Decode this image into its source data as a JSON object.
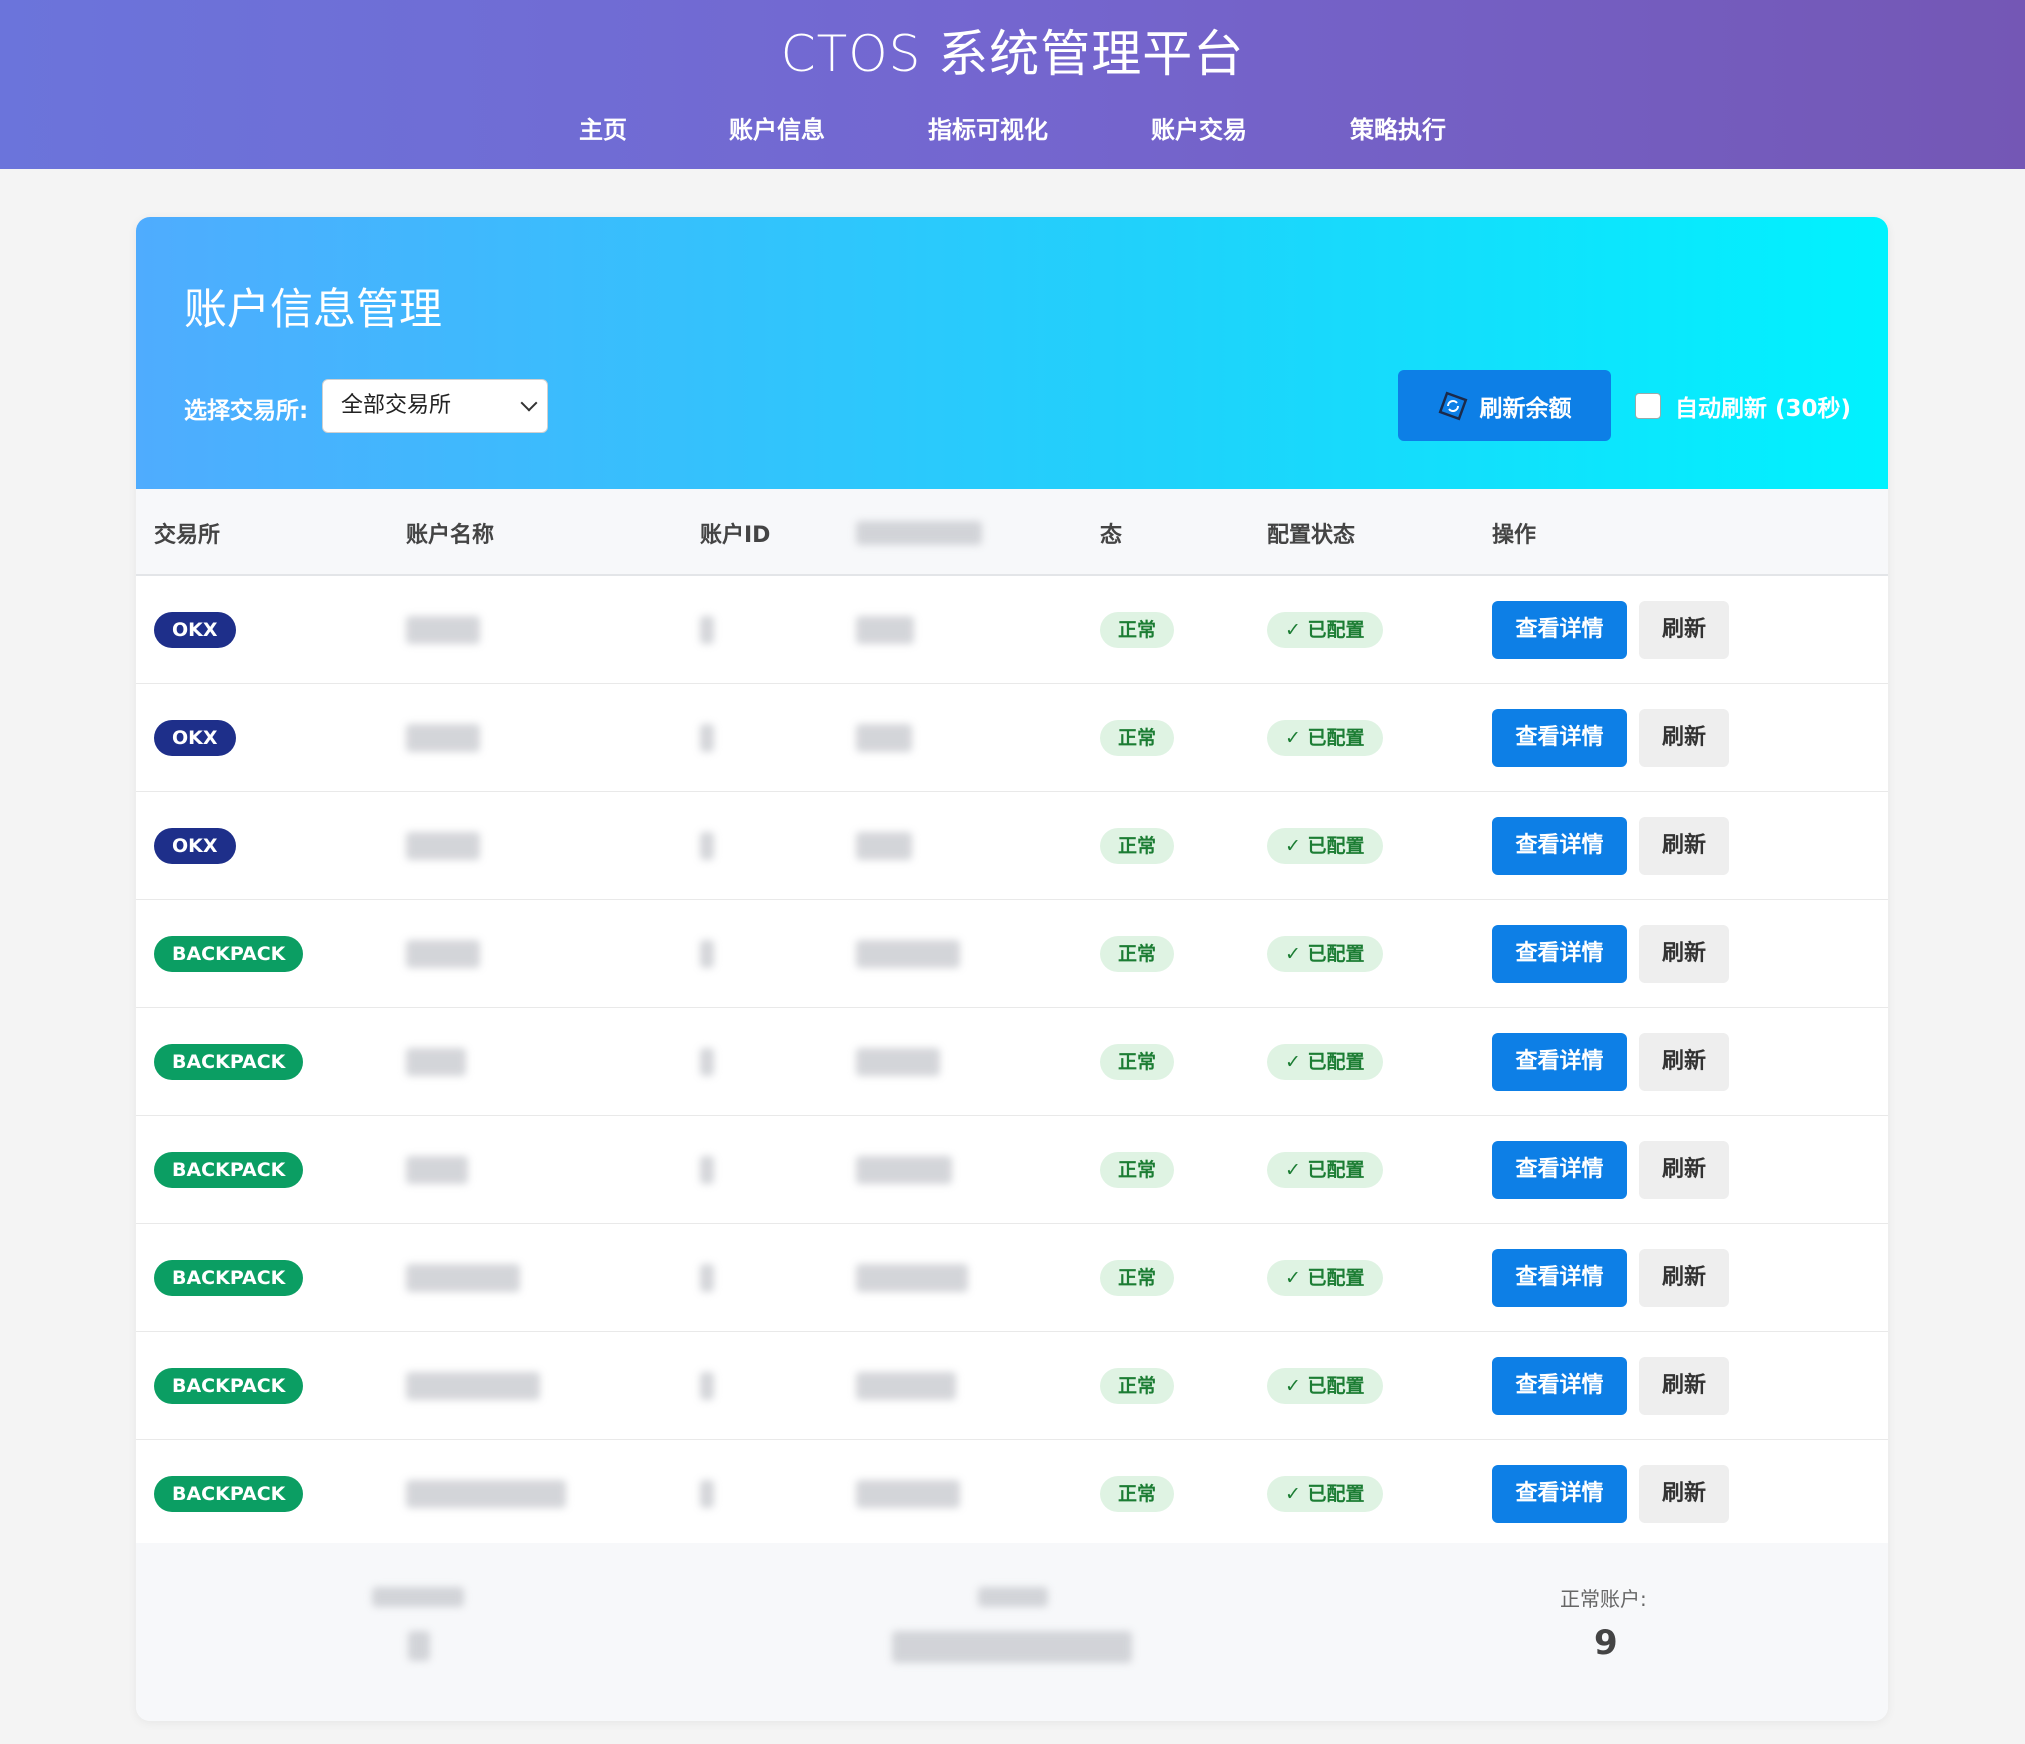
{
  "app": {
    "title": "CTOS 系统管理平台",
    "nav": [
      "主页",
      "账户信息",
      "指标可视化",
      "账户交易",
      "策略执行"
    ]
  },
  "panel": {
    "heading": "账户信息管理",
    "exchange_label": "选择交易所:",
    "exchange_selected": "全部交易所",
    "refresh_balance_label": "刷新余额",
    "auto_refresh_label": "自动刷新 (30秒)",
    "auto_refresh_checked": false
  },
  "table": {
    "headers": [
      "交易所",
      "账户名称",
      "账户ID",
      "",
      "态",
      "配置状态",
      "操作"
    ],
    "rows": [
      {
        "exchange": "OKX",
        "status": "正常",
        "config": "✓ 已配置",
        "view": "查看详情",
        "refresh": "刷新"
      },
      {
        "exchange": "OKX",
        "status": "正常",
        "config": "✓ 已配置",
        "view": "查看详情",
        "refresh": "刷新"
      },
      {
        "exchange": "OKX",
        "status": "正常",
        "config": "✓ 已配置",
        "view": "查看详情",
        "refresh": "刷新"
      },
      {
        "exchange": "BACKPACK",
        "status": "正常",
        "config": "✓ 已配置",
        "view": "查看详情",
        "refresh": "刷新"
      },
      {
        "exchange": "BACKPACK",
        "status": "正常",
        "config": "✓ 已配置",
        "view": "查看详情",
        "refresh": "刷新"
      },
      {
        "exchange": "BACKPACK",
        "status": "正常",
        "config": "✓ 已配置",
        "view": "查看详情",
        "refresh": "刷新"
      },
      {
        "exchange": "BACKPACK",
        "status": "正常",
        "config": "✓ 已配置",
        "view": "查看详情",
        "refresh": "刷新"
      },
      {
        "exchange": "BACKPACK",
        "status": "正常",
        "config": "✓ 已配置",
        "view": "查看详情",
        "refresh": "刷新"
      },
      {
        "exchange": "BACKPACK",
        "status": "正常",
        "config": "✓ 已配置",
        "view": "查看详情",
        "refresh": "刷新"
      }
    ]
  },
  "summary": {
    "normal_accounts_label": "正常账户:",
    "normal_accounts_value": "9"
  },
  "colors": {
    "header_gradient_start": "#6b74db",
    "header_gradient_end": "#7457b5",
    "card_gradient_start": "#4facfe",
    "card_gradient_end": "#00f2fe",
    "primary": "#0d7fe6",
    "okx": "#1e2f8a",
    "backpack": "#0b9e63",
    "status_bg": "#dff3e3",
    "status_text": "#1c7d34"
  }
}
